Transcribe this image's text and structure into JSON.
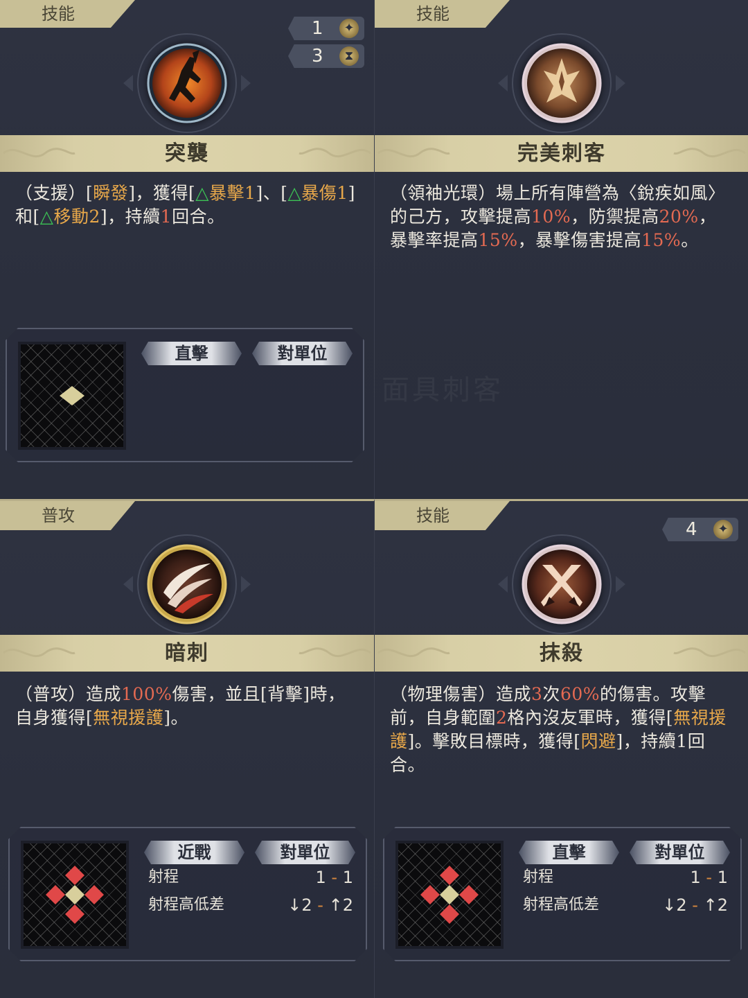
{
  "cards": [
    {
      "category": "技能",
      "counters": [
        {
          "value": "1",
          "icon": "star-icon"
        },
        {
          "value": "3",
          "icon": "hourglass-icon"
        }
      ],
      "name": "突襲",
      "description": {
        "p1": "（支援）[",
        "h1": "瞬發",
        "p2": "]，獲得[",
        "t1": "△",
        "h2": "暴擊1",
        "p3": "]、[",
        "t2": "△",
        "h3": "暴傷1",
        "p4": "]和[",
        "t3": "△",
        "h4": "移動2",
        "p5": "]，持續",
        "n1": "1",
        "p6": "回合。"
      },
      "chips": [
        "直擊",
        "對單位"
      ]
    },
    {
      "category": "技能",
      "name": "完美刺客",
      "watermark": "面具刺客",
      "description": {
        "p1": "（領袖光環）場上所有陣營為〈銳疾如風〉的己方，攻擊提高",
        "v1": "10%",
        "p2": "，防禦提高",
        "v2": "20%",
        "p3": "，暴擊率提高",
        "v3": "15%",
        "p4": "，暴擊傷害提高",
        "v4": "15%",
        "p5": "。"
      }
    },
    {
      "category": "普攻",
      "name": "暗刺",
      "description": {
        "p1": "（普攻）造成",
        "v1": "100%",
        "p2": "傷害，並且[背擊]時，自身獲得[",
        "h1": "無視援護",
        "p3": "]。"
      },
      "chips": [
        "近戰",
        "對單位"
      ],
      "stats": [
        {
          "label": "射程",
          "from": "1",
          "sep": "-",
          "to": "1"
        },
        {
          "label": "射程高低差",
          "from": "↓2",
          "sep": "-",
          "to": "↑2"
        }
      ]
    },
    {
      "category": "技能",
      "counters": [
        {
          "value": "4",
          "icon": "star-icon"
        }
      ],
      "name": "抹殺",
      "description": {
        "p1": "（物理傷害）造成",
        "v1": "3",
        "p2": "次",
        "v2": "60%",
        "p3": "的傷害。攻擊前，自身範圍",
        "v3": "2",
        "p4": "格內沒友軍時，獲得[",
        "h1": "無視援護",
        "p5": "]。擊敗目標時，獲得[",
        "h2": "閃避",
        "p6": "]，持續1回合。"
      },
      "chips": [
        "直擊",
        "對單位"
      ],
      "stats": [
        {
          "label": "射程",
          "from": "1",
          "sep": "-",
          "to": "1"
        },
        {
          "label": "射程高低差",
          "from": "↓2",
          "sep": "-",
          "to": "↑2"
        }
      ]
    }
  ],
  "colors": {
    "highlight_orange": "#e8a84a",
    "percent_red": "#e46a52",
    "buff_green": "#3cc254",
    "banner_gold": "#d8cfa6",
    "background": "#2a2e3c"
  }
}
